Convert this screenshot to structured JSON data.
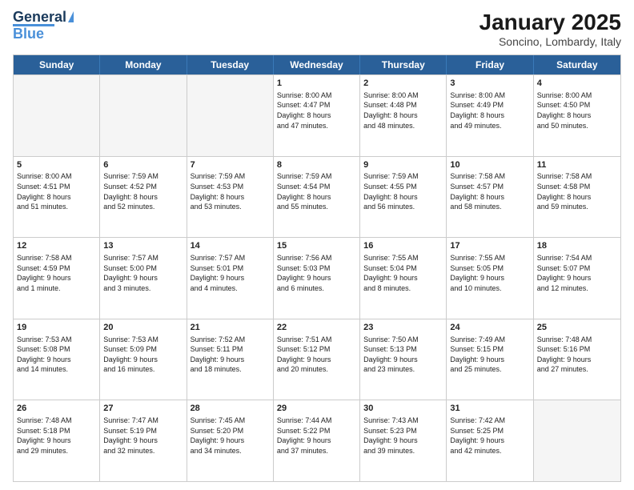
{
  "logo": {
    "line1": "General",
    "line2": "Blue"
  },
  "title": "January 2025",
  "subtitle": "Soncino, Lombardy, Italy",
  "header_days": [
    "Sunday",
    "Monday",
    "Tuesday",
    "Wednesday",
    "Thursday",
    "Friday",
    "Saturday"
  ],
  "weeks": [
    [
      {
        "day": "",
        "empty": true
      },
      {
        "day": "",
        "empty": true
      },
      {
        "day": "",
        "empty": true
      },
      {
        "day": "1",
        "text": "Sunrise: 8:00 AM\nSunset: 4:47 PM\nDaylight: 8 hours\nand 47 minutes."
      },
      {
        "day": "2",
        "text": "Sunrise: 8:00 AM\nSunset: 4:48 PM\nDaylight: 8 hours\nand 48 minutes."
      },
      {
        "day": "3",
        "text": "Sunrise: 8:00 AM\nSunset: 4:49 PM\nDaylight: 8 hours\nand 49 minutes."
      },
      {
        "day": "4",
        "text": "Sunrise: 8:00 AM\nSunset: 4:50 PM\nDaylight: 8 hours\nand 50 minutes."
      }
    ],
    [
      {
        "day": "5",
        "text": "Sunrise: 8:00 AM\nSunset: 4:51 PM\nDaylight: 8 hours\nand 51 minutes."
      },
      {
        "day": "6",
        "text": "Sunrise: 7:59 AM\nSunset: 4:52 PM\nDaylight: 8 hours\nand 52 minutes."
      },
      {
        "day": "7",
        "text": "Sunrise: 7:59 AM\nSunset: 4:53 PM\nDaylight: 8 hours\nand 53 minutes."
      },
      {
        "day": "8",
        "text": "Sunrise: 7:59 AM\nSunset: 4:54 PM\nDaylight: 8 hours\nand 55 minutes."
      },
      {
        "day": "9",
        "text": "Sunrise: 7:59 AM\nSunset: 4:55 PM\nDaylight: 8 hours\nand 56 minutes."
      },
      {
        "day": "10",
        "text": "Sunrise: 7:58 AM\nSunset: 4:57 PM\nDaylight: 8 hours\nand 58 minutes."
      },
      {
        "day": "11",
        "text": "Sunrise: 7:58 AM\nSunset: 4:58 PM\nDaylight: 8 hours\nand 59 minutes."
      }
    ],
    [
      {
        "day": "12",
        "text": "Sunrise: 7:58 AM\nSunset: 4:59 PM\nDaylight: 9 hours\nand 1 minute."
      },
      {
        "day": "13",
        "text": "Sunrise: 7:57 AM\nSunset: 5:00 PM\nDaylight: 9 hours\nand 3 minutes."
      },
      {
        "day": "14",
        "text": "Sunrise: 7:57 AM\nSunset: 5:01 PM\nDaylight: 9 hours\nand 4 minutes."
      },
      {
        "day": "15",
        "text": "Sunrise: 7:56 AM\nSunset: 5:03 PM\nDaylight: 9 hours\nand 6 minutes."
      },
      {
        "day": "16",
        "text": "Sunrise: 7:55 AM\nSunset: 5:04 PM\nDaylight: 9 hours\nand 8 minutes."
      },
      {
        "day": "17",
        "text": "Sunrise: 7:55 AM\nSunset: 5:05 PM\nDaylight: 9 hours\nand 10 minutes."
      },
      {
        "day": "18",
        "text": "Sunrise: 7:54 AM\nSunset: 5:07 PM\nDaylight: 9 hours\nand 12 minutes."
      }
    ],
    [
      {
        "day": "19",
        "text": "Sunrise: 7:53 AM\nSunset: 5:08 PM\nDaylight: 9 hours\nand 14 minutes."
      },
      {
        "day": "20",
        "text": "Sunrise: 7:53 AM\nSunset: 5:09 PM\nDaylight: 9 hours\nand 16 minutes."
      },
      {
        "day": "21",
        "text": "Sunrise: 7:52 AM\nSunset: 5:11 PM\nDaylight: 9 hours\nand 18 minutes."
      },
      {
        "day": "22",
        "text": "Sunrise: 7:51 AM\nSunset: 5:12 PM\nDaylight: 9 hours\nand 20 minutes."
      },
      {
        "day": "23",
        "text": "Sunrise: 7:50 AM\nSunset: 5:13 PM\nDaylight: 9 hours\nand 23 minutes."
      },
      {
        "day": "24",
        "text": "Sunrise: 7:49 AM\nSunset: 5:15 PM\nDaylight: 9 hours\nand 25 minutes."
      },
      {
        "day": "25",
        "text": "Sunrise: 7:48 AM\nSunset: 5:16 PM\nDaylight: 9 hours\nand 27 minutes."
      }
    ],
    [
      {
        "day": "26",
        "text": "Sunrise: 7:48 AM\nSunset: 5:18 PM\nDaylight: 9 hours\nand 29 minutes."
      },
      {
        "day": "27",
        "text": "Sunrise: 7:47 AM\nSunset: 5:19 PM\nDaylight: 9 hours\nand 32 minutes."
      },
      {
        "day": "28",
        "text": "Sunrise: 7:45 AM\nSunset: 5:20 PM\nDaylight: 9 hours\nand 34 minutes."
      },
      {
        "day": "29",
        "text": "Sunrise: 7:44 AM\nSunset: 5:22 PM\nDaylight: 9 hours\nand 37 minutes."
      },
      {
        "day": "30",
        "text": "Sunrise: 7:43 AM\nSunset: 5:23 PM\nDaylight: 9 hours\nand 39 minutes."
      },
      {
        "day": "31",
        "text": "Sunrise: 7:42 AM\nSunset: 5:25 PM\nDaylight: 9 hours\nand 42 minutes."
      },
      {
        "day": "",
        "empty": true
      }
    ]
  ]
}
